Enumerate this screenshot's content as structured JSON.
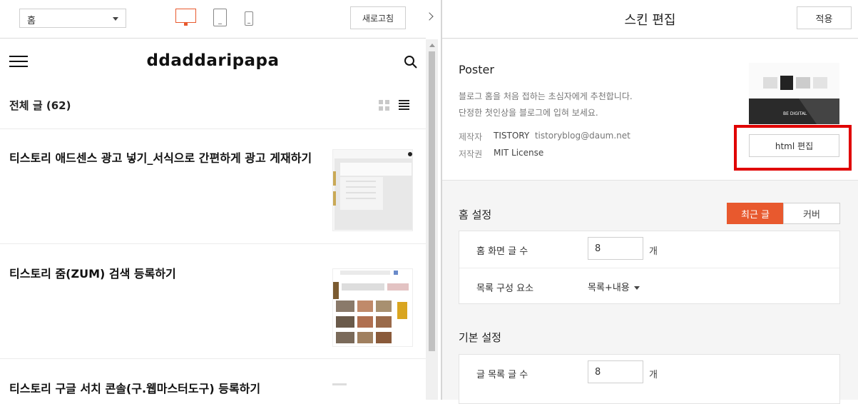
{
  "preview": {
    "page_select": "홈",
    "refresh_label": "새로고침",
    "blog_title": "ddaddaripapa",
    "list_heading": "전체 글 (62)",
    "posts": [
      {
        "title": "티스토리 애드센스 광고 넣기_서식으로 간편하게 광고 게재하기"
      },
      {
        "title": "티스토리 줌(ZUM) 검색 등록하기"
      },
      {
        "title": "티스토리 구글 서치 콘솔(구.웹마스터도구) 등록하기"
      }
    ]
  },
  "editor": {
    "title": "스킨 편집",
    "apply_label": "적용",
    "skin": {
      "name": "Poster",
      "desc_line1": "블로그 홈을 처음 접하는 초심자에게 추천합니다.",
      "desc_line2": "단정한 첫인상을 블로그에 입혀 보세요.",
      "maker_label": "제작자",
      "maker_name": "TISTORY",
      "maker_email": "tistoryblog@daum.net",
      "license_label": "저작권",
      "license_value": "MIT License",
      "html_edit_label": "html 편집",
      "thumb_caption": "BE DIGITAL"
    },
    "home_settings": {
      "title": "홈 설정",
      "tab_recent": "최근 글",
      "tab_cover": "커버",
      "post_count_label": "홈 화면 글 수",
      "post_count_value": "8",
      "unit": "개",
      "list_element_label": "목록 구성 요소",
      "list_element_value": "목록+내용"
    },
    "basic_settings": {
      "title": "기본 설정",
      "list_count_label": "글 목록 글 수",
      "list_count_value": "8",
      "unit": "개"
    }
  },
  "colors": {
    "accent": "#e8592e",
    "highlight": "#e00000"
  }
}
